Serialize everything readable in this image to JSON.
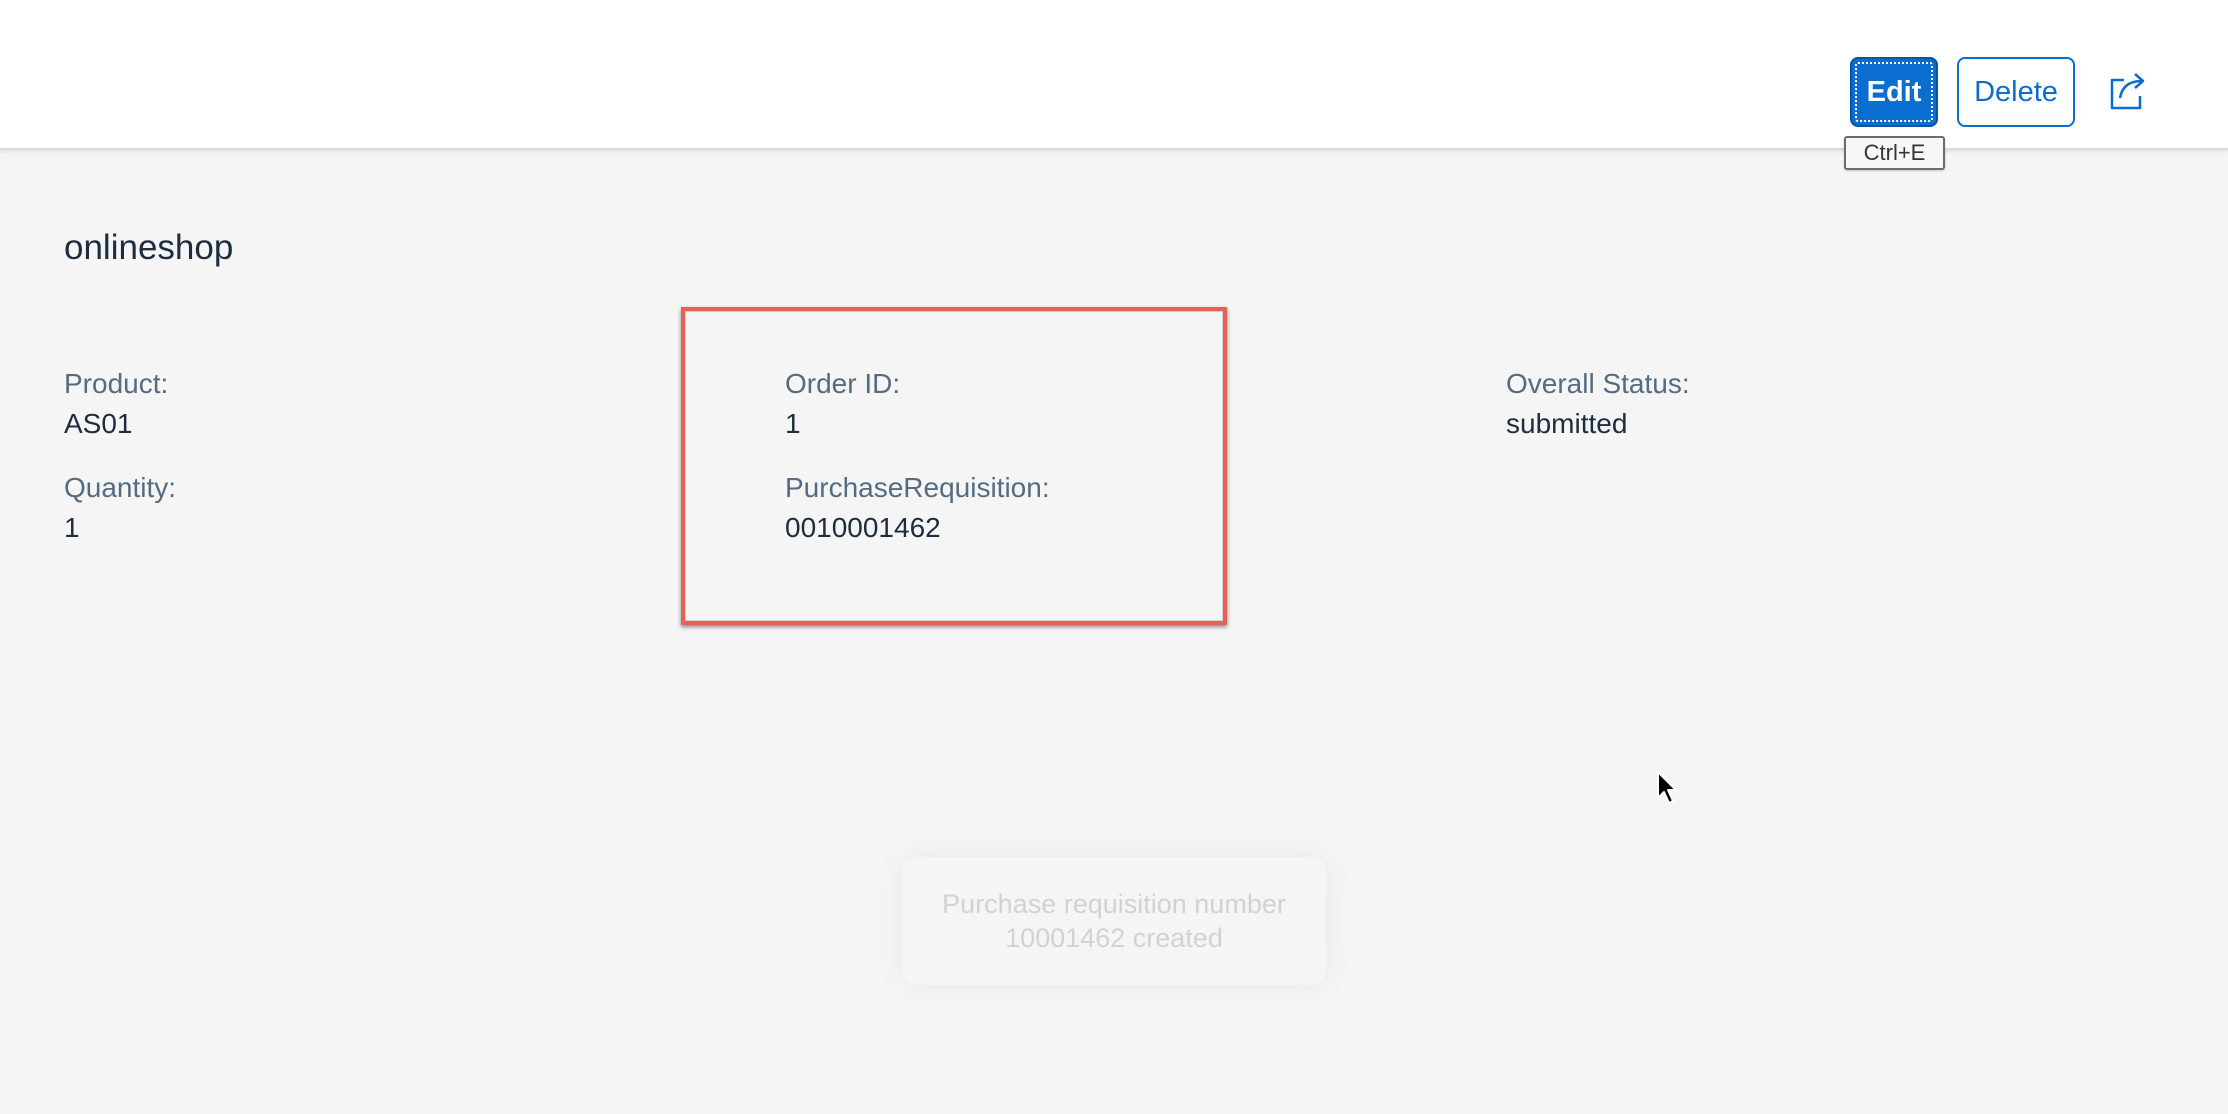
{
  "toolbar": {
    "edit_label": "Edit",
    "delete_label": "Delete",
    "share_icon": "share-icon",
    "edit_tooltip": "Ctrl+E"
  },
  "page": {
    "title": "onlineshop"
  },
  "fields": {
    "product_label": "Product:",
    "product_value": "AS01",
    "quantity_label": "Quantity:",
    "quantity_value": "1",
    "order_id_label": "Order ID:",
    "order_id_value": "1",
    "purchase_req_label": "PurchaseRequisition:",
    "purchase_req_value": "0010001462",
    "overall_status_label": "Overall Status:",
    "overall_status_value": "submitted"
  },
  "toast": {
    "line1": "Purchase requisition number",
    "line2": "10001462 created"
  },
  "colors": {
    "accent": "#0a6ed1",
    "highlight": "#e8605a",
    "background": "#f5f5f5"
  }
}
